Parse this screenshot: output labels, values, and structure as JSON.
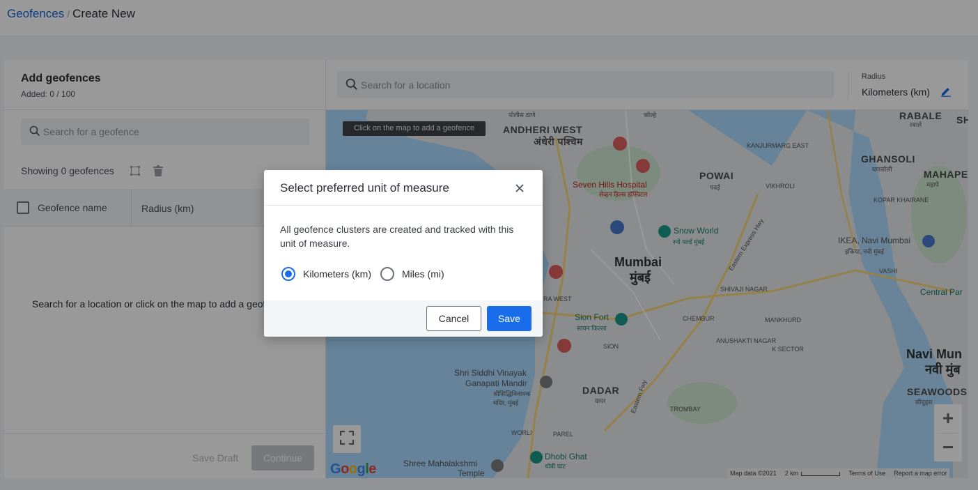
{
  "breadcrumb": {
    "parent": "Geofences",
    "separator": "/",
    "current": "Create New"
  },
  "left_panel": {
    "title": "Add geofences",
    "added": "Added: 0 / 100",
    "search_placeholder": "Search for a geofence",
    "showing": "Showing 0 geofences",
    "columns": {
      "name": "Geofence name",
      "radius": "Radius (km)"
    },
    "empty_message": "Search for a location or click on the map to add a geofence",
    "save_draft": "Save Draft",
    "continue": "Continue"
  },
  "location_bar": {
    "search_placeholder": "Search for a location",
    "radius_label": "Radius",
    "radius_value": "Kilometers (km)"
  },
  "map": {
    "hint": "Click on the map to add a geofence",
    "labels": {
      "andheri_west": "ANDHERI WEST",
      "andheri_west_hi": "अंधेरी पश्चिम",
      "powai": "POWAI",
      "powai_hi": "पवई",
      "mumbai": "Mumbai",
      "mumbai_hi": "मुंबई",
      "ghansoli": "GHANSOLI",
      "ghansoli_hi": "घणसोली",
      "rabale": "RABALE",
      "rabale_hi": "रबाले",
      "mahape": "MAHAPE",
      "mahape_hi": "महापे",
      "kanjurmarg": "KANJURMARG EAST",
      "vikhroli": "VIKHROLI",
      "kopar_khairane": "KOPAR KHAIRANE",
      "vashi": "VASHI",
      "shivaji_nagar": "SHIVAJI NAGAR",
      "chembur": "CHEMBUR",
      "mankhurd": "MANKHURD",
      "anushakti": "ANUSHAKTI NAGAR",
      "k_sector": "K SECTOR",
      "sion": "SION",
      "dadar": "DADAR",
      "dadar_hi": "दादर",
      "trombay": "TROMBAY",
      "worli": "WORLI",
      "parel": "PAREL",
      "navi_mumbai": "Navi Mun",
      "navi_mumbai_hi": "नवी मुंब",
      "seawoods": "SEAWOODS",
      "seawoods_hi": "सीवूड्स",
      "central_park": "Central Par",
      "eastern_express": "Eastern Express Hwy",
      "eastern_fwy": "Eastern Fwy",
      "police_thane": "पोलीस ठाणे",
      "kolhi": "कोल्हे",
      "ra_west": "RA WEST",
      "sh": "SH"
    },
    "pois": {
      "seven_hills": "Seven Hills Hospital",
      "seven_hills_hi": "सेव्हन हिल्स हॉस्पिटल",
      "snow_world": "Snow World",
      "snow_world_hi": "स्नो वर्ल्ड मुंबई",
      "ikea": "IKEA, Navi Mumbai",
      "ikea_hi": "इकिया, नवी मुंबई",
      "sion_fort": "Sion Fort",
      "sion_fort_hi": "सायन किल्ला",
      "siddhivinayak": "Shri Siddhi Vinayak",
      "siddhivinayak_2": "Ganapati Mandir",
      "siddhivinayak_hi": "श्रीसिद्धिविनायक मंदिर, मुंबई",
      "dhobi_ghat": "Dhobi Ghat",
      "dhobi_ghat_hi": "धोबी घाट",
      "mahalakshmi": "Shree Mahalakshmi",
      "mahalakshmi_2": "Temple"
    },
    "footer": {
      "map_data": "Map data ©2021",
      "scale": "2 km",
      "terms": "Terms of Use",
      "report": "Report a map error"
    },
    "google": "Google",
    "zoom_in": "+",
    "zoom_out": "−"
  },
  "modal": {
    "title": "Select preferred unit of measure",
    "description": "All geofence clusters are created and tracked with this unit of measure.",
    "options": [
      {
        "label": "Kilometers (km)",
        "selected": true
      },
      {
        "label": "Miles (mi)",
        "selected": false
      }
    ],
    "cancel": "Cancel",
    "save": "Save"
  },
  "colors": {
    "accent": "#1a6dea",
    "link": "#1565d8",
    "water": "#aadaff",
    "land": "#e8eaed"
  }
}
